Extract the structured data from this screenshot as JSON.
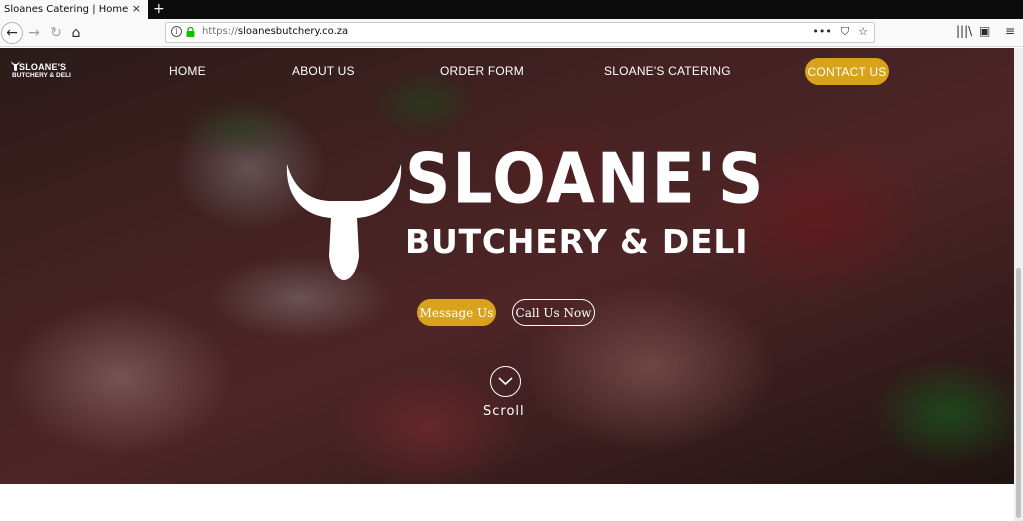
{
  "browser": {
    "tab_title": "Sloanes Catering | Home",
    "tab_close": "×",
    "new_tab": "+",
    "url_protocol": "https://",
    "url_domain": "sloanesbutchery.co.za",
    "url_actions": [
      "•••",
      "⛉",
      "☆"
    ],
    "toolbar_right": [
      "|||\\",
      "▣",
      "≡"
    ]
  },
  "site": {
    "logo_line1": "SLOANE'S",
    "logo_line2": "BUTCHERY & DELI",
    "menu": [
      "HOME",
      "ABOUT US",
      "ORDER FORM",
      "SLOANE'S CATERING"
    ],
    "contact_label": "CONTACT US",
    "accent_color": "#d9a21b"
  },
  "hero": {
    "title": "SLOANE'S",
    "subtitle": "BUTCHERY & DELI",
    "message_button": "Message Us",
    "call_button": "Call Us Now",
    "scroll_label": "Scroll"
  }
}
